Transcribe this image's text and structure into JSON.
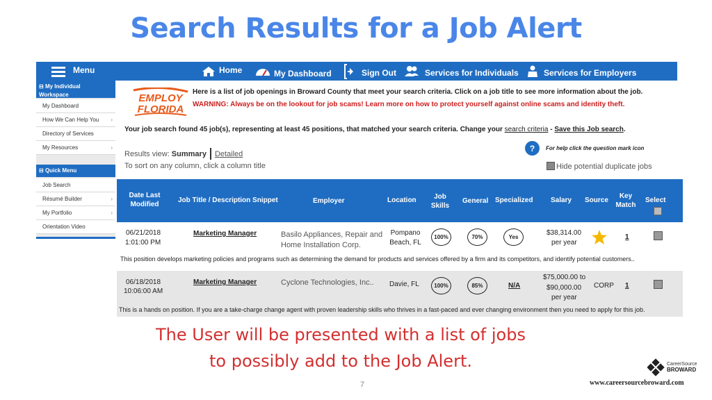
{
  "slide": {
    "title": "Search Results for a Job Alert",
    "caption_line1": "The User will be presented with a list of jobs",
    "caption_line2": "to possibly add to the Job Alert.",
    "page_number": "7",
    "url": "www.careersourcebroward.com",
    "brand_line1": "CareerSource",
    "brand_line2": "BROWARD"
  },
  "topnav": {
    "menu": "Menu",
    "home": "Home",
    "dashboard": "My Dashboard",
    "signout": "Sign Out",
    "individuals": "Services for Individuals",
    "employers": "Services for Employers"
  },
  "sidebar": {
    "workspace_header": "My Individual Workspace",
    "workspace_items": [
      "My Dashboard",
      "How We Can Help You",
      "Directory of Services",
      "My Resources"
    ],
    "quickmenu_header": "Quick Menu",
    "quickmenu_items": [
      "Job Search",
      "Résumé Builder",
      "My Portfolio",
      "Orientation Video"
    ]
  },
  "logo": {
    "line1": "EMPLOY",
    "line2": "FLORIDA"
  },
  "content": {
    "intro": "Here is a list of job openings in Broward County that meet your search criteria.  Click on a job title to see more information about the job.",
    "warning": "WARNING: Always be on the lookout for job scams! Learn more on how to protect yourself against online scams and identity theft.",
    "found_prefix": "Your job search found 45 job(s), representing at least 45 positions, that matched your search criteria. Change your",
    "search_criteria_link": "search criteria",
    "found_sep": " - ",
    "save_search_link": "Save this Job search",
    "results_view_label": "Results view:",
    "summary": "Summary",
    "detailed": "Detailed",
    "sort_hint": "To sort on any column, click a column title",
    "help_icon": "?",
    "help_text": "For help click the question mark icon",
    "hide_duplicates": "Hide potential duplicate jobs"
  },
  "table": {
    "headers": {
      "date": "Date Last Modified",
      "title": "Job Title / Description Snippet",
      "employer": "Employer",
      "location": "Location",
      "job_skills": "Job Skills",
      "general": "General",
      "specialized": "Specialized",
      "salary": "Salary",
      "source": "Source",
      "key_match": "Key Match",
      "select": "Select"
    },
    "rows": [
      {
        "date": "06/21/2018",
        "time": "1:01:00  PM",
        "title": "Marketing Manager",
        "employer": "Basilo Appliances, Repair and Home Installation Corp.",
        "location": "Pompano Beach, FL",
        "job_skills": "100%",
        "general": "70%",
        "specialized": "Yes",
        "salary_line1": "$38,314.00",
        "salary_line2": "per year",
        "source": "★",
        "key_match": "1",
        "description": "This position develops marketing policies and programs such as determining the demand for products and services offered by a firm and its competitors, and identify potential customers.."
      },
      {
        "date": "06/18/2018",
        "time": "10:06:00  AM",
        "title": "Marketing Manager",
        "employer": "Cyclone Technologies, Inc..",
        "location": "Davie, FL",
        "job_skills": "100%",
        "general": "85%",
        "specialized": "N/A",
        "salary_line1": "$75,000.00 to",
        "salary_line2": "$90,000.00",
        "salary_line3": "per year",
        "source": "CORP",
        "key_match": "1",
        "description": "This is a hands on position. If you are a take-charge change agent with proven leadership skills who thrives in a fast-paced and ever changing environment then you need to apply for this job."
      }
    ]
  },
  "colors": {
    "title_blue": "#4a86e8",
    "nav_blue": "#1f6dc2",
    "warning_red": "#cc1f1f",
    "caption_red": "#d32f2f",
    "star_gold": "#f5b800"
  },
  "icons": [
    "hamburger-icon",
    "home-icon",
    "dashboard-gauge-icon",
    "sign-out-icon",
    "users-icon",
    "briefcase-user-icon",
    "question-mark-icon",
    "star-icon"
  ]
}
